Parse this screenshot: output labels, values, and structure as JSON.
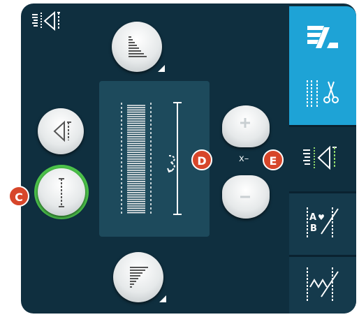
{
  "markers": {
    "c": "C",
    "d": "D",
    "e": "E"
  },
  "stepper": {
    "mirror_label": "x–"
  },
  "colors": {
    "panel": "#0f2f3f",
    "accent_blue": "#1ea3d6",
    "green_ring": "#4cc24a",
    "marker": "#d7462a"
  },
  "icons": {
    "top_left": "stitch-positioning-icon",
    "sidebar": [
      "stitch-menu-icon",
      "scissors-tie-off-icon",
      "stitch-positioning-icon",
      "sequence-abc-icon",
      "stitch-program-icon"
    ],
    "buttons": [
      "taper-start-icon",
      "taper-end-icon",
      "mirror-side-icon",
      "single-stitch-icon",
      "increase-icon",
      "decrease-icon"
    ]
  }
}
